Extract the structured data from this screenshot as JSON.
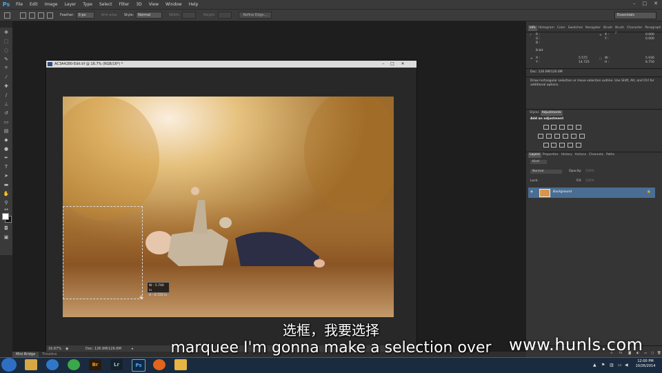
{
  "app": {
    "logo": "Ps",
    "menus": [
      "File",
      "Edit",
      "Image",
      "Layer",
      "Type",
      "Select",
      "Filter",
      "3D",
      "View",
      "Window",
      "Help"
    ]
  },
  "options_bar": {
    "feather_label": "Feather:",
    "feather_value": "0 px",
    "antialias_label": "Anti-alias",
    "style_label": "Style:",
    "style_value": "Normal",
    "width_label": "Width:",
    "height_label": "Height:",
    "refine_edge": "Refine Edge...",
    "workspace": "Essentials"
  },
  "document": {
    "title": "AC3A4280-Edit.tif @ 16.7% (RGB/16*) *",
    "zoom": "16.67%",
    "doc_size": "Doc: 126.6M/126.6M"
  },
  "selection_readout": {
    "w": "W :   5.700 in",
    "h": "H :   6.725 in"
  },
  "mini_bridge": {
    "tabs": [
      "Mini Bridge",
      "Timeline"
    ]
  },
  "panels": {
    "info_tabs": [
      "Info",
      "Histogram",
      "Color",
      "Swatches",
      "Navigator",
      "Brush",
      "Brush P",
      "Character",
      "Paragraph"
    ],
    "info": {
      "r": "R :",
      "g": "G :",
      "b": "B :",
      "x1": "X :",
      "y1": "Y :",
      "x1v": "0.000",
      "y1v": "0.000",
      "bit": "8-bit",
      "x2": "X :",
      "y2": "Y :",
      "x2v": "5.575",
      "y2v": "14.725",
      "w": "W :",
      "h": "H :",
      "wv": "5.930",
      "hv": "6.750",
      "doc": "Doc: 126.6M/126.6M",
      "hint": "Draw rectangular selection or move selection outline.  Use Shift, Alt, and Ctrl for additional options."
    },
    "adj_tabs": [
      "Styles",
      "Adjustments"
    ],
    "adj_title": "Add an adjustment",
    "layer_tabs": [
      "Layers",
      "Properties",
      "History",
      "Actions",
      "Channels",
      "Paths"
    ],
    "layers": {
      "kind": "Kind",
      "blend": "Normal",
      "opacity_label": "Opacity:",
      "opacity": "100%",
      "lock_label": "Lock:",
      "fill_label": "Fill:",
      "fill": "100%",
      "layer_name": "Background"
    }
  },
  "taskbar": {
    "apps": [
      "Br",
      "Lr",
      "Ps"
    ],
    "time": "12:00 PM",
    "date": "10/26/2014"
  },
  "subtitles": {
    "cn": "选框，我要选择",
    "en": "marquee I'm gonna make a selection over"
  },
  "watermark": "www.hunls.com"
}
